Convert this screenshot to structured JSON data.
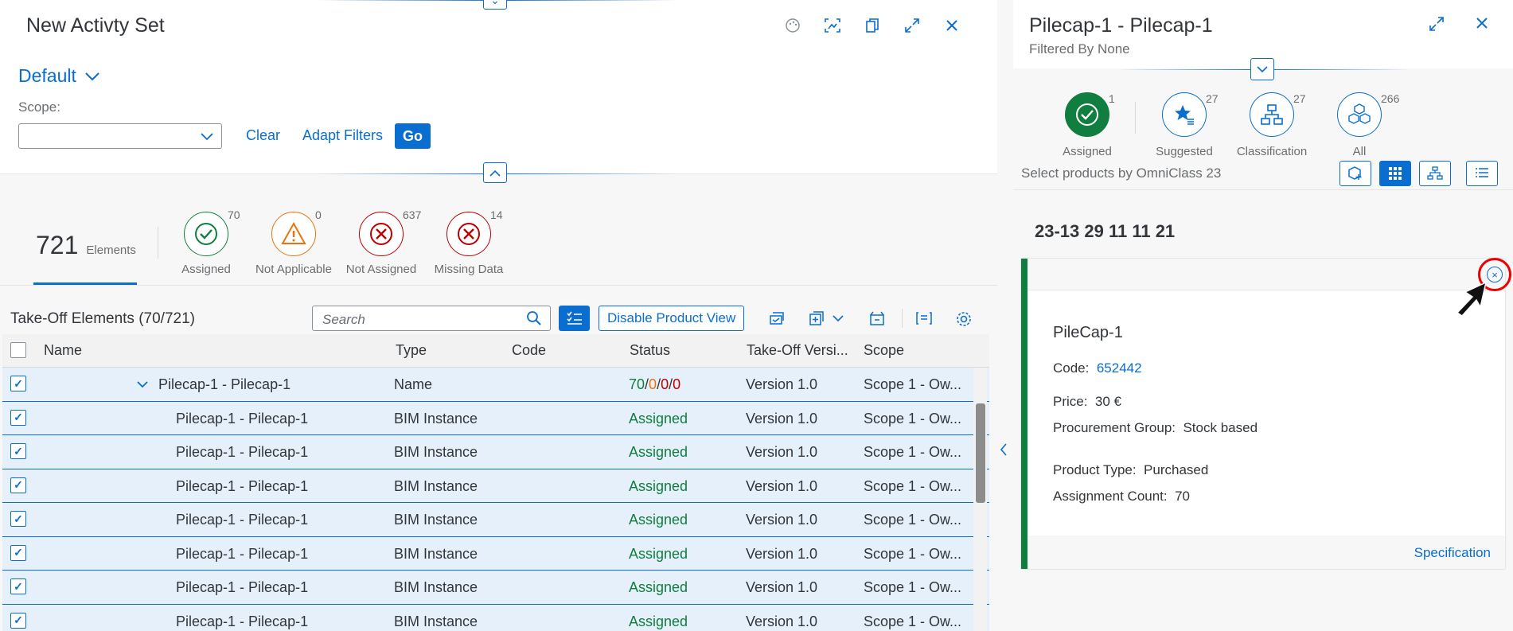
{
  "left": {
    "title": "New Activty Set",
    "variant": "Default",
    "scope_label": "Scope:",
    "clear": "Clear",
    "adapt_filters": "Adapt Filters",
    "go": "Go",
    "kpi_total": "721",
    "kpi_total_label": "Elements",
    "kpis": [
      {
        "label": "Assigned",
        "count": "70",
        "color": "#107e3e",
        "icon": "check-icon"
      },
      {
        "label": "Not Applicable",
        "count": "0",
        "color": "#e9730c",
        "icon": "warning-icon"
      },
      {
        "label": "Not Assigned",
        "count": "637",
        "color": "#bb0000",
        "icon": "error-icon"
      },
      {
        "label": "Missing Data",
        "count": "14",
        "color": "#bb0000",
        "icon": "error-icon"
      }
    ],
    "table_title": "Take-Off Elements (70/721)",
    "search_placeholder": "Search",
    "disable_product_view": "Disable Product View",
    "columns": [
      "Name",
      "Type",
      "Code",
      "Status",
      "Take-Off Versi...",
      "Scope"
    ],
    "group_row": {
      "name": "Pilecap-1 - Pilecap-1",
      "type": "Name",
      "status_a": "70",
      "status_b": "0",
      "status_c": "0",
      "status_d": "0",
      "sep": "/",
      "version": "Version 1.0",
      "scope": "Scope 1 - Ow..."
    },
    "rows": [
      {
        "name": "Pilecap-1 - Pilecap-1",
        "type": "BIM Instance",
        "status": "Assigned",
        "version": "Version 1.0",
        "scope": "Scope 1 - Ow..."
      },
      {
        "name": "Pilecap-1 - Pilecap-1",
        "type": "BIM Instance",
        "status": "Assigned",
        "version": "Version 1.0",
        "scope": "Scope 1 - Ow..."
      },
      {
        "name": "Pilecap-1 - Pilecap-1",
        "type": "BIM Instance",
        "status": "Assigned",
        "version": "Version 1.0",
        "scope": "Scope 1 - Ow..."
      },
      {
        "name": "Pilecap-1 - Pilecap-1",
        "type": "BIM Instance",
        "status": "Assigned",
        "version": "Version 1.0",
        "scope": "Scope 1 - Ow..."
      },
      {
        "name": "Pilecap-1 - Pilecap-1",
        "type": "BIM Instance",
        "status": "Assigned",
        "version": "Version 1.0",
        "scope": "Scope 1 - Ow..."
      },
      {
        "name": "Pilecap-1 - Pilecap-1",
        "type": "BIM Instance",
        "status": "Assigned",
        "version": "Version 1.0",
        "scope": "Scope 1 - Ow..."
      },
      {
        "name": "Pilecap-1 - Pilecap-1",
        "type": "BIM Instance",
        "status": "Assigned",
        "version": "Version 1.0",
        "scope": "Scope 1 - Ow..."
      }
    ]
  },
  "right": {
    "title": "Pilecap-1 - Pilecap-1",
    "subtitle": "Filtered By None",
    "tabs": [
      {
        "label": "Assigned",
        "count": "1"
      },
      {
        "label": "Suggested",
        "count": "27"
      },
      {
        "label": "Classification",
        "count": "27"
      },
      {
        "label": "All",
        "count": "266"
      }
    ],
    "filter_text": "Select products by OmniClass 23",
    "code": "23-13 29 11 11 21",
    "card": {
      "name": "PileCap-1",
      "code_label": "Code:",
      "code_value": "652442",
      "price_label": "Price:",
      "price_value": "30 €",
      "procurement_label": "Procurement Group:",
      "procurement_value": "Stock based",
      "product_type_label": "Product Type:",
      "product_type_value": "Purchased",
      "assignment_label": "Assignment Count:",
      "assignment_value": "70",
      "specification": "Specification"
    }
  }
}
